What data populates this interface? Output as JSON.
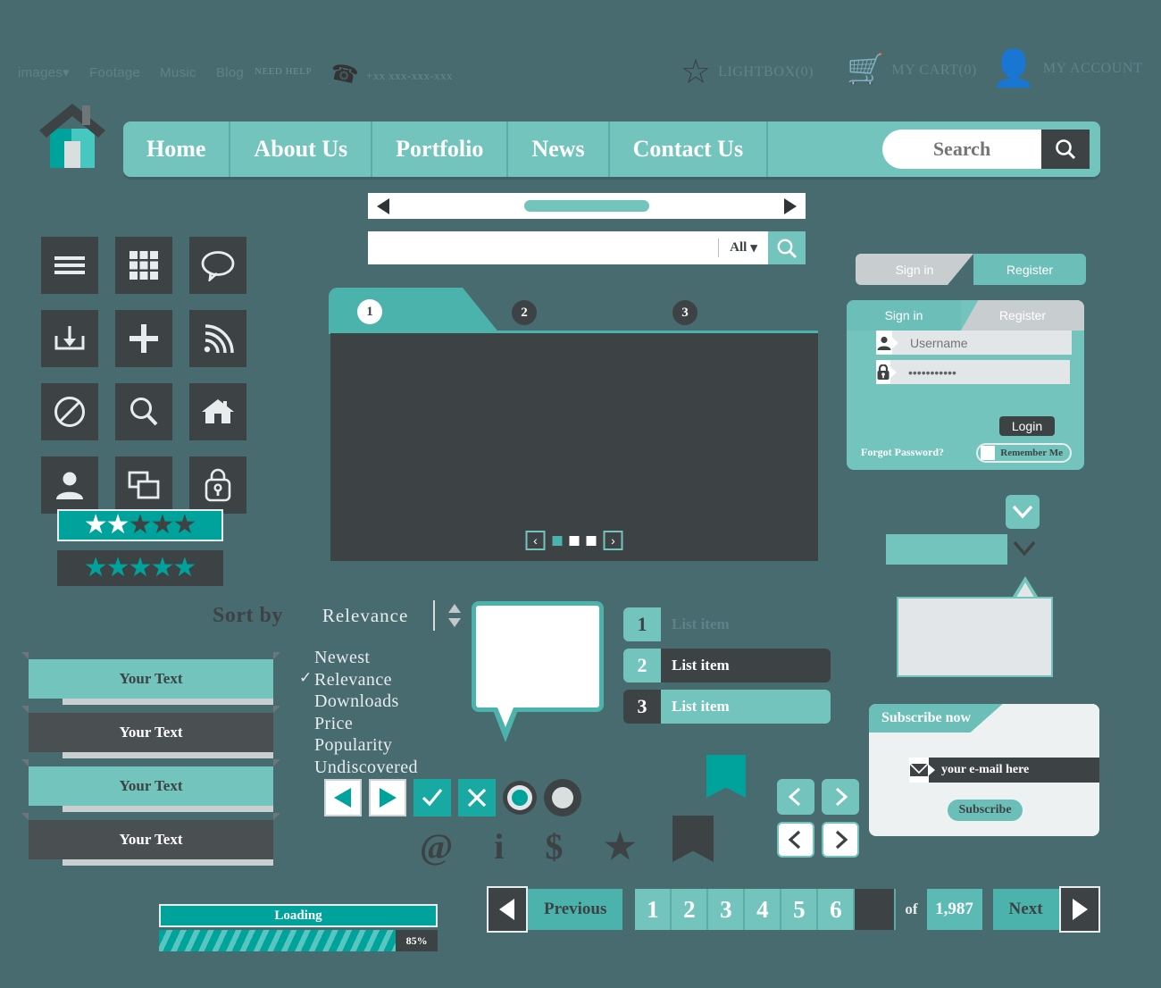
{
  "theme": {
    "bg": "#486b70",
    "teal": "#72c4bc",
    "teal_deep": "#00a39c",
    "teal_mid": "#4bb3ac",
    "dark": "#3d4245",
    "light": "#e8eced"
  },
  "top_bar": {
    "links": [
      "images▾",
      "Footage",
      "Music",
      "Blog"
    ],
    "need_help_label": "NEED HELP",
    "phone_icon": "phone-icon",
    "phone_number": "+xx xxx-xxx-xxx",
    "utilities": [
      {
        "label": "LIGHTBOX(0)",
        "icon": "star-outline-icon"
      },
      {
        "label": "MY CART(0)",
        "icon": "shopping-cart-icon"
      },
      {
        "label": "MY ACCOUNT",
        "icon": "user-icon"
      }
    ]
  },
  "logo": {
    "icon": "house-logo-icon"
  },
  "main_nav": {
    "items": [
      "Home",
      "About Us",
      "Portfolio",
      "News",
      "Contact Us"
    ],
    "search": {
      "placeholder": "Search",
      "value": "",
      "icon": "search-icon"
    }
  },
  "icon_grid": {
    "icons": [
      "menu-hamburger-icon",
      "grid-view-icon",
      "chat-bubble-icon",
      "download-icon",
      "plus-icon",
      "rss-feed-icon",
      "block-forbidden-icon",
      "search-magnifier-icon",
      "home-icon",
      "user-profile-icon",
      "copy-windows-icon",
      "lock-icon"
    ]
  },
  "ratings": [
    {
      "name": "rating-light-on-teal",
      "bg": "#00a39c",
      "filled": 2,
      "total": 5,
      "filled_color": "#ffffff",
      "empty_color": "#3d4245"
    },
    {
      "name": "rating-teal-on-dark",
      "bg": "#3d4245",
      "filled": 5,
      "total": 5,
      "filled_color": "#00a39c",
      "empty_color": "#00a39c"
    }
  ],
  "ribbons": [
    {
      "label": "Your Text",
      "style": "teal"
    },
    {
      "label": "Your Text",
      "style": "dark"
    },
    {
      "label": "Your Text",
      "style": "teal"
    },
    {
      "label": "Your Text",
      "style": "dark"
    }
  ],
  "loading": {
    "title": "Loading",
    "percent_label": "85%",
    "percent_value": 85
  },
  "scrollbar": {
    "left_arrow_icon": "triangle-left-icon",
    "right_arrow_icon": "triangle-right-icon",
    "thumb_position_percent": 35
  },
  "search_bar_all": {
    "value": "",
    "placeholder": "",
    "scope_label": "All",
    "scope_caret": "▾",
    "search_icon": "search-icon"
  },
  "tabs": {
    "items": [
      {
        "number": "1",
        "active": true
      },
      {
        "number": "2",
        "active": false
      },
      {
        "number": "3",
        "active": false
      }
    ]
  },
  "player": {
    "prev_icon": "chevron-left-icon",
    "next_icon": "chevron-right-icon",
    "prev_label": "‹",
    "next_label": "›",
    "dots": [
      true,
      false,
      false
    ]
  },
  "sort": {
    "label": "Sort by",
    "value": "Relevance",
    "stepper_icon": "updown-arrows-icon",
    "options": [
      {
        "label": "Newest",
        "checked": false
      },
      {
        "label": "Relevance",
        "checked": true
      },
      {
        "label": "Downloads",
        "checked": false
      },
      {
        "label": "Price",
        "checked": false
      },
      {
        "label": "Popularity",
        "checked": false
      },
      {
        "label": "Undiscovered",
        "checked": false
      }
    ],
    "check_glyph": "✓"
  },
  "speech_bubble": {
    "name": "speech-bubble-callout",
    "text": ""
  },
  "numbered_list": [
    {
      "number": "1",
      "label": "List item",
      "num_bg": "#72c4bc",
      "num_color": "#3d4245",
      "row_bg": "transparent",
      "row_color": "#5d8287"
    },
    {
      "number": "2",
      "label": "List item",
      "num_bg": "#72c4bc",
      "num_color": "#ffffff",
      "row_bg": "#3d4245",
      "row_color": "#ffffff"
    },
    {
      "number": "3",
      "label": "List item",
      "num_bg": "#3d4245",
      "num_color": "#ffffff",
      "row_bg": "#72c4bc",
      "row_color": "#ffffff"
    }
  ],
  "controls": [
    {
      "icon": "play-back-icon",
      "style": "white-teal-triangle-left"
    },
    {
      "icon": "play-forward-icon",
      "style": "white-teal-triangle-right"
    },
    {
      "icon": "check-icon",
      "style": "teal-check"
    },
    {
      "icon": "close-x-icon",
      "style": "teal-x"
    },
    {
      "icon": "radio-selected-teal-icon",
      "style": "radio-teal"
    },
    {
      "icon": "radio-selected-light-icon",
      "style": "radio-light"
    }
  ],
  "glyphs": [
    {
      "glyph": "@",
      "name": "at-sign-icon"
    },
    {
      "glyph": "i",
      "name": "info-icon"
    },
    {
      "glyph": "$",
      "name": "dollar-icon"
    },
    {
      "glyph": "★",
      "name": "star-filled-icon"
    }
  ],
  "bookmarks": [
    {
      "name": "bookmark-ribbon-teal",
      "color": "#00a39c"
    },
    {
      "name": "bookmark-ribbon-dark",
      "color": "#3d4245"
    }
  ],
  "chevron_pairs": [
    {
      "icon": "chevron-left-icon",
      "style": "teal"
    },
    {
      "icon": "chevron-right-icon",
      "style": "teal"
    },
    {
      "icon": "chevron-left-icon",
      "style": "white"
    },
    {
      "icon": "chevron-right-icon",
      "style": "white"
    }
  ],
  "pagination": {
    "prev_arrow_icon": "triangle-left-icon",
    "prev_label": "Previous",
    "pages": [
      "1",
      "2",
      "3",
      "4",
      "5",
      "6"
    ],
    "current_page_blank": "",
    "of_label": "of",
    "total_pages": "1,987",
    "next_label": "Next",
    "next_arrow_icon": "triangle-right-icon"
  },
  "auth_tabs_variant": {
    "signin_label": "Sign in",
    "register_label": "Register",
    "active": "Register"
  },
  "login_panel": {
    "signin_tab": "Sign in",
    "register_tab": "Register",
    "active_tab": "Sign in",
    "username": {
      "placeholder": "Username",
      "value": "Username",
      "icon": "user-icon"
    },
    "password": {
      "value": "•••••••••••",
      "icon": "lock-icon"
    },
    "login_button": "Login",
    "forgot_link": "Forgot Password?",
    "remember_label": "Remember Me",
    "remember_checked": false
  },
  "dropdowns": {
    "chevron_button_icon": "chevron-down-icon",
    "bar_value": "",
    "bar_chevron_icon": "chevron-down-icon",
    "tooltip_text": ""
  },
  "subscribe": {
    "title": "Subscribe now",
    "email_placeholder": "your e-mail here",
    "email_value": "your e-mail here",
    "email_icon": "envelope-icon",
    "button_label": "Subscribe"
  }
}
